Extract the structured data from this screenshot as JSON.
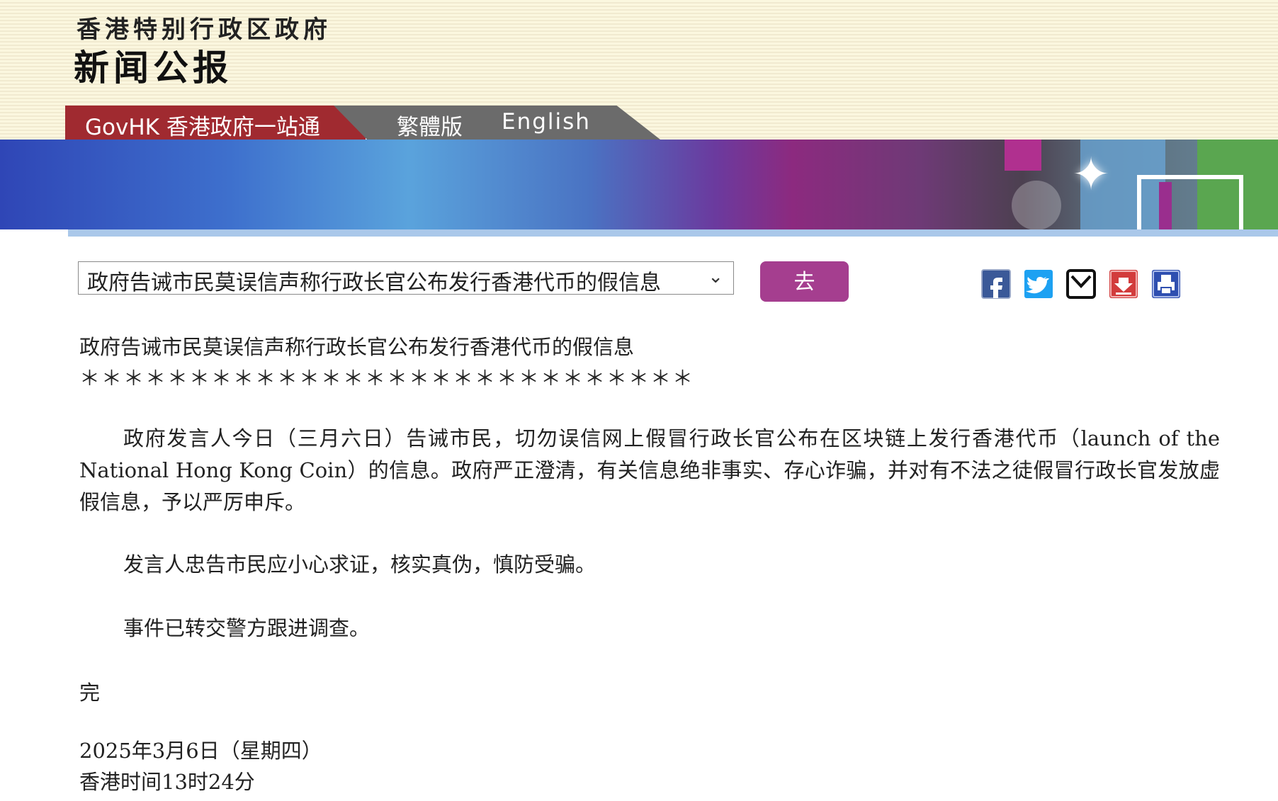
{
  "header": {
    "brand_top": "香港特别行政区政府",
    "brand_main": "新闻公报"
  },
  "nav": {
    "govhk": "GovHK 香港政府一站通",
    "traditional": "繁體版",
    "english": "English"
  },
  "colors": {
    "nav_red": "#a02a30",
    "nav_grey": "#6b6b6b",
    "go_button": "#a53e8f"
  },
  "selector": {
    "value": "政府告诫市民莫误信声称行政长官公布发行香港代币的假信息",
    "go_label": "去"
  },
  "share_icons": [
    "facebook-icon",
    "twitter-icon",
    "mail-icon",
    "download-icon",
    "print-icon"
  ],
  "article": {
    "title": "政府告诫市民莫误信声称行政长官公布发行香港代币的假信息",
    "stars": "＊＊＊＊＊＊＊＊＊＊＊＊＊＊＊＊＊＊＊＊＊＊＊＊＊＊＊＊",
    "paragraphs": [
      "政府发言人今日（三月六日）告诫市民，切勿误信网上假冒行政长官公布在区块链上发行香港代币（launch of the National Hong Kong Coin）的信息。政府严正澄清，有关信息绝非事实、存心诈骗，并对有不法之徒假冒行政长官发放虚假信息，予以严厉申斥。",
      "发言人忠告市民应小心求证，核实真伪，慎防受骗。",
      "事件已转交警方跟进调查。"
    ],
    "end_mark": "完",
    "date": "2025年3月6日（星期四）",
    "time": "香港时间13时24分"
  }
}
